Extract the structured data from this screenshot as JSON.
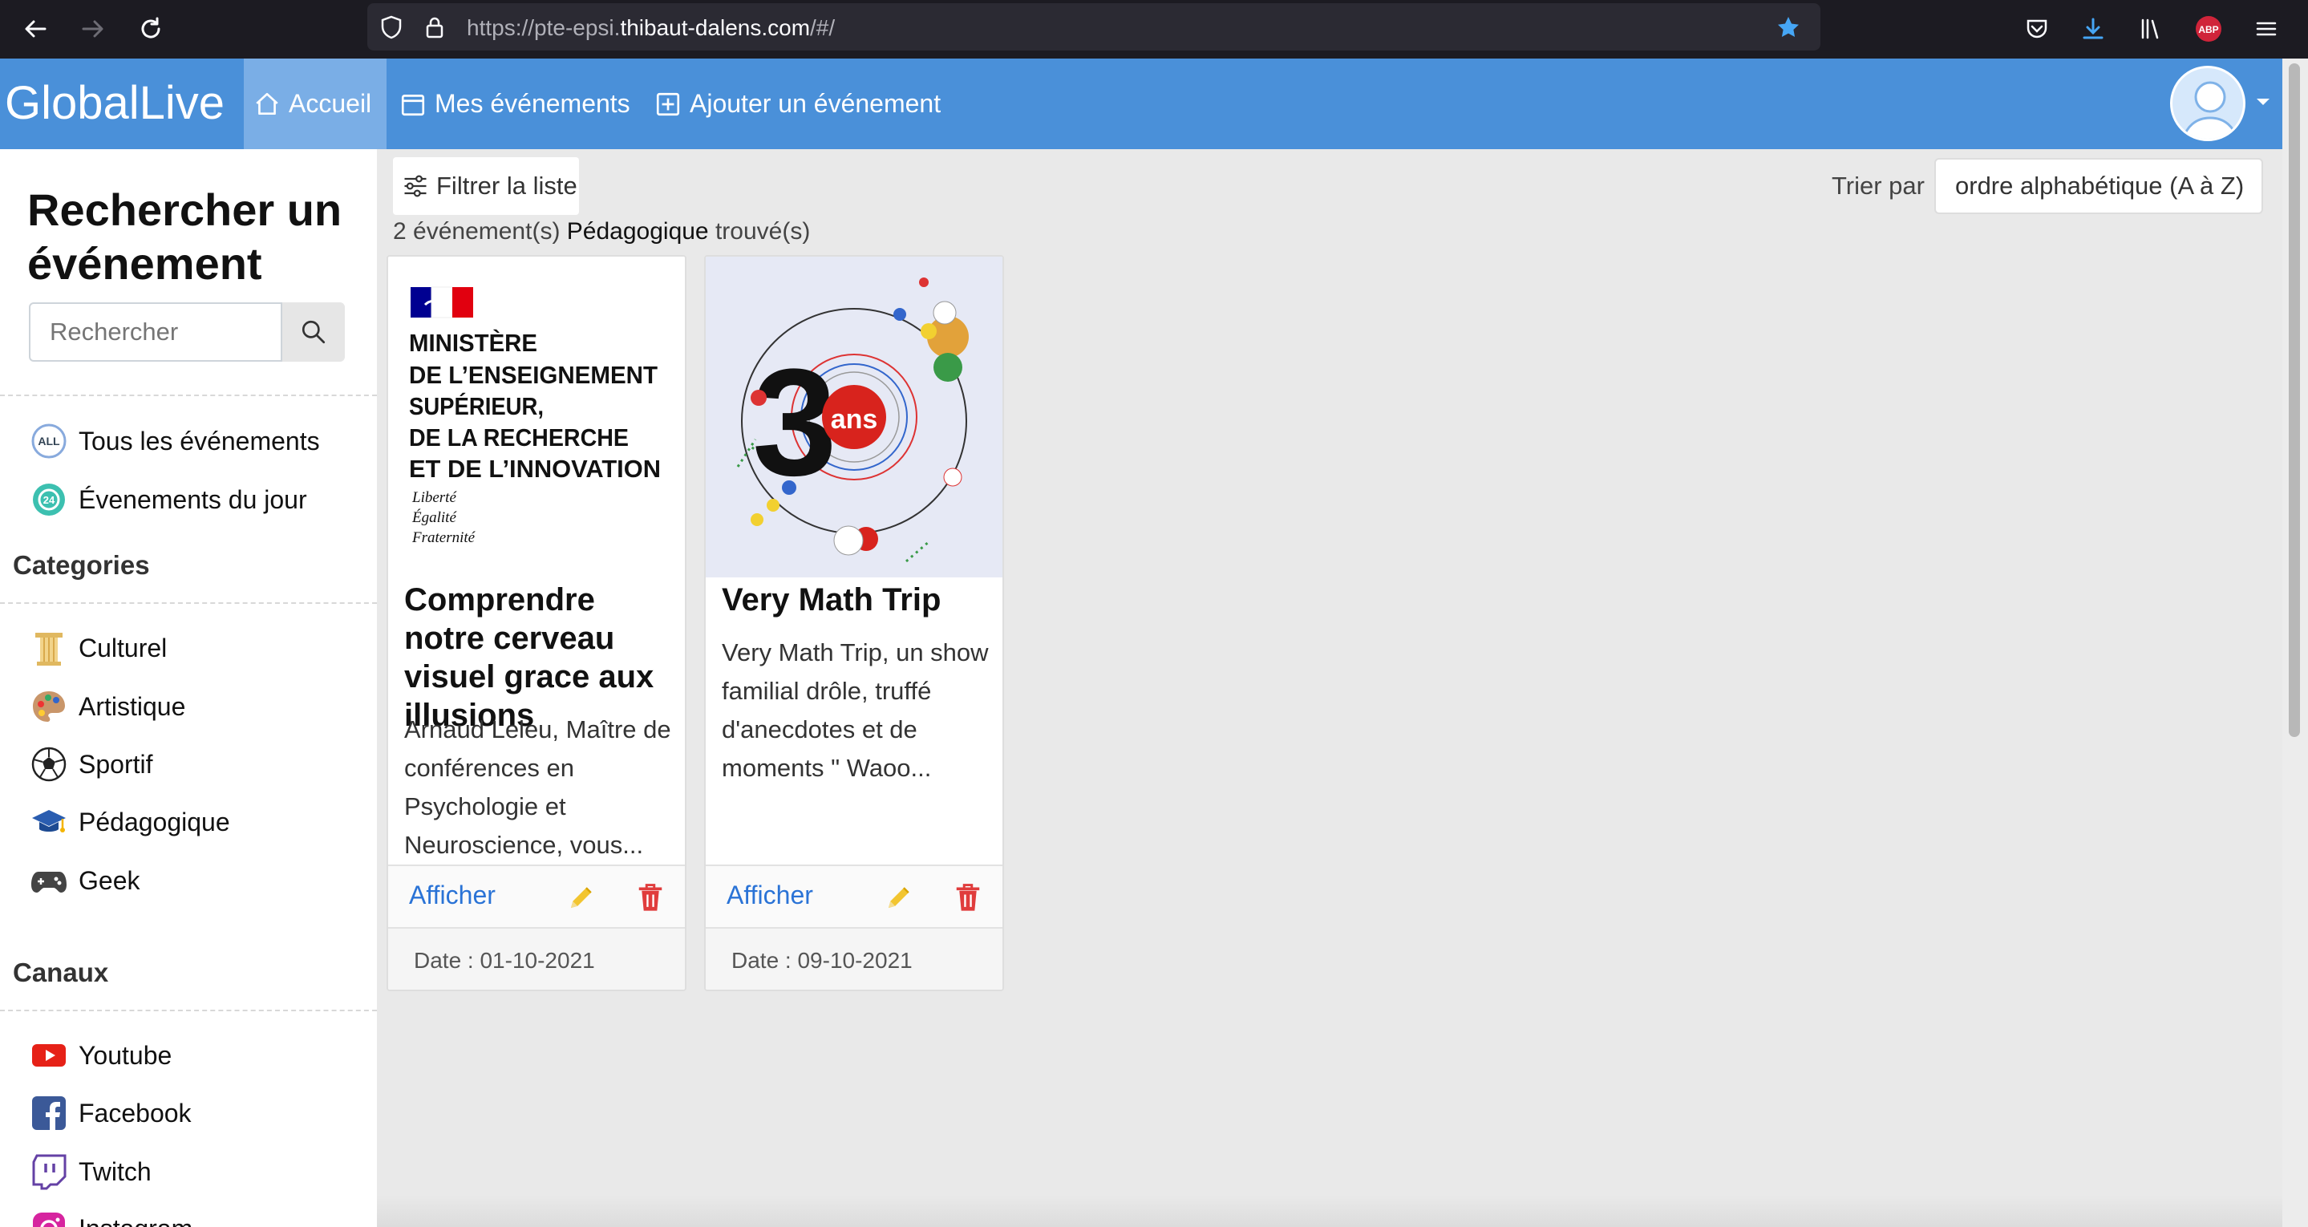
{
  "browser": {
    "url_prefix": "https://pte-epsi.",
    "url_domain": "thibaut-dalens.com",
    "url_suffix": "/#/",
    "abp_label": "ABP"
  },
  "navbar": {
    "brand": "GlobalLive",
    "links": [
      {
        "label": "Accueil",
        "icon": "home-icon",
        "active": true
      },
      {
        "label": "Mes événements",
        "icon": "calendar-icon"
      },
      {
        "label": "Ajouter un événement",
        "icon": "plus-square-icon"
      }
    ],
    "accent": "#4a90d9"
  },
  "sidebar": {
    "title": "Rechercher un événement",
    "search_placeholder": "Rechercher",
    "quick": [
      {
        "label": "Tous les événements",
        "icon": "all-icon"
      },
      {
        "label": "Évenements du jour",
        "icon": "24h-icon"
      }
    ],
    "categories_heading": "Categories",
    "categories": [
      {
        "label": "Culturel",
        "icon": "column-icon"
      },
      {
        "label": "Artistique",
        "icon": "palette-icon"
      },
      {
        "label": "Sportif",
        "icon": "soccer-ball-icon"
      },
      {
        "label": "Pédagogique",
        "icon": "graduation-cap-icon"
      },
      {
        "label": "Geek",
        "icon": "gamepad-icon"
      }
    ],
    "channels_heading": "Canaux",
    "channels": [
      {
        "label": "Youtube",
        "icon": "youtube-icon"
      },
      {
        "label": "Facebook",
        "icon": "facebook-icon"
      },
      {
        "label": "Twitch",
        "icon": "twitch-icon"
      },
      {
        "label": "Instagram",
        "icon": "instagram-icon"
      }
    ]
  },
  "main": {
    "filter_label": "Filtrer la liste",
    "sort_label": "Trier par",
    "sort_value": "ordre alphabétique (A à Z)",
    "result_prefix": "2 événement(s)",
    "result_category": "Pédagogique",
    "result_suffix": "trouvé(s)",
    "cards": [
      {
        "title": "Comprendre notre cerveau visuel grace aux illusions",
        "description": "Arnaud Leleu, Maître de conférences en Psychologie et Neuroscience, vous...",
        "show_label": "Afficher",
        "date": "Date : 01-10-2021",
        "image": {
          "line1": "MINISTÈRE",
          "line2": "DE L’ENSEIGNEMENT",
          "line3": "SUPÉRIEUR,",
          "line4": "DE LA RECHERCHE",
          "line5": "ET DE L’INNOVATION",
          "motto1": "Liberté",
          "motto2": "Égalité",
          "motto3": "Fraternité"
        }
      },
      {
        "title": "Very Math Trip",
        "description": "Very Math Trip, un show familial drôle, truffé d'anecdotes et de moments \" Waoo...",
        "show_label": "Afficher",
        "date": "Date : 09-10-2021",
        "image": {
          "digit": "3",
          "badge": "ans"
        }
      }
    ]
  }
}
